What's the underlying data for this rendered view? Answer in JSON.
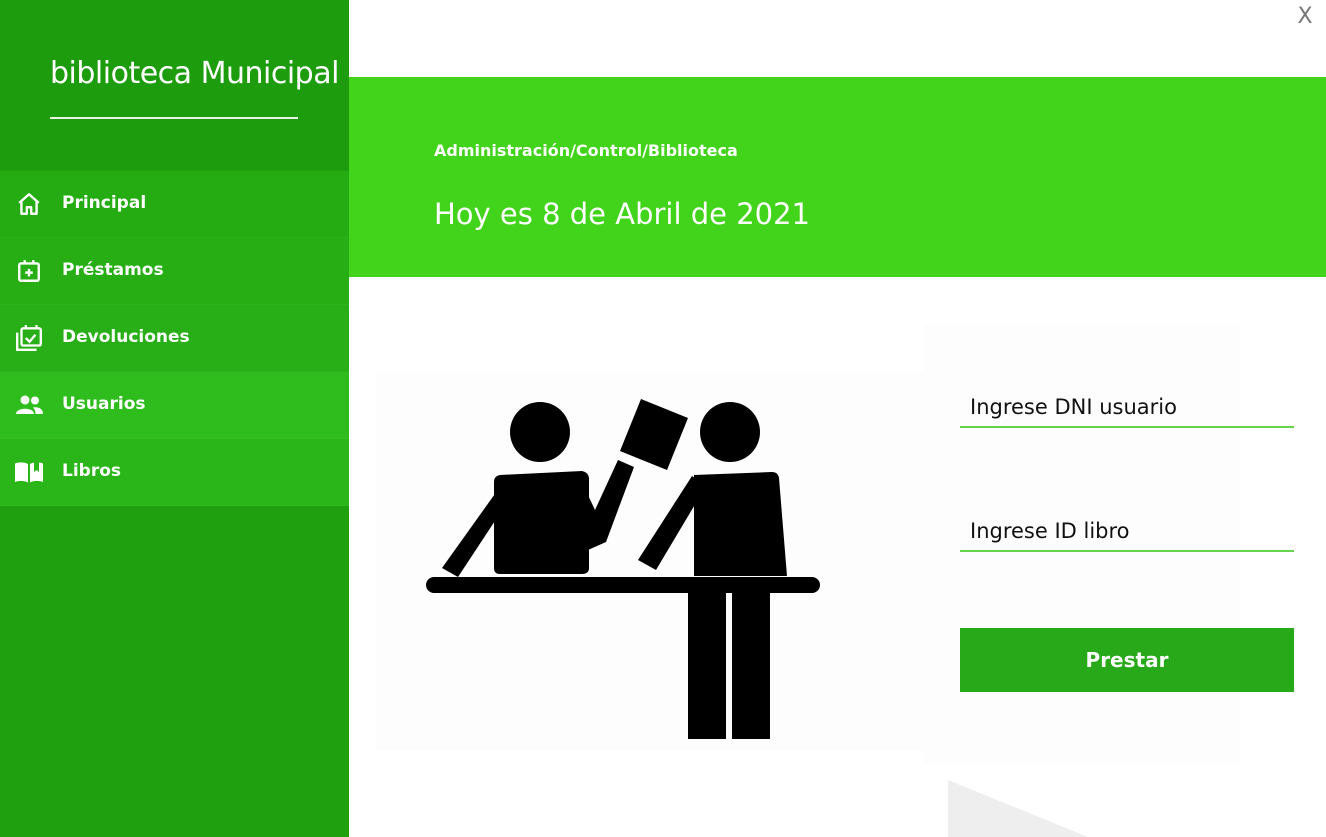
{
  "app": {
    "title": "biblioteca Municipal",
    "close_label": "X"
  },
  "sidebar": {
    "items": [
      {
        "label": "Principal",
        "icon": "home-icon"
      },
      {
        "label": "Préstamos",
        "icon": "calendar-plus-icon"
      },
      {
        "label": "Devoluciones",
        "icon": "calendar-check-icon"
      },
      {
        "label": "Usuarios",
        "icon": "users-icon"
      },
      {
        "label": "Libros",
        "icon": "book-open-icon"
      }
    ]
  },
  "header": {
    "breadcrumb": "Administración/Control/Biblioteca",
    "date_text": "Hoy es 8 de Abril de 2021"
  },
  "form": {
    "dni_placeholder": "Ingrese DNI usuario",
    "book_placeholder": "Ingrese ID libro",
    "submit_label": "Prestar"
  },
  "colors": {
    "sidebar": "#1fa10f",
    "banner": "#42d31b",
    "button": "#27a91a",
    "field_underline": "#63d44b"
  }
}
